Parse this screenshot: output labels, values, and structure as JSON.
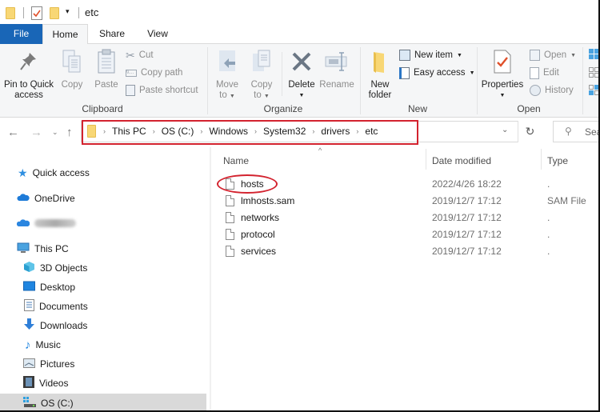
{
  "window": {
    "title": "etc"
  },
  "quick_access_toolbar": [
    "folder-icon",
    "properties-icon",
    "new-folder-icon",
    "customize-dropdown"
  ],
  "tabs": [
    {
      "label": "File",
      "active": false
    },
    {
      "label": "Home",
      "active": true
    },
    {
      "label": "Share",
      "active": false
    },
    {
      "label": "View",
      "active": false
    }
  ],
  "ribbon": {
    "clipboard": {
      "label": "Clipboard",
      "pin": "Pin to Quick access",
      "pin_line1": "Pin to Quick",
      "pin_line2": "access",
      "copy": "Copy",
      "paste": "Paste",
      "cut": "Cut",
      "copy_path": "Copy path",
      "paste_shortcut": "Paste shortcut"
    },
    "organize": {
      "label": "Organize",
      "move_to_1": "Move",
      "move_to_2": "to",
      "copy_to_1": "Copy",
      "copy_to_2": "to",
      "delete": "Delete",
      "rename": "Rename"
    },
    "new": {
      "label": "New",
      "new_folder_1": "New",
      "new_folder_2": "folder",
      "new_item": "New item",
      "easy_access": "Easy access"
    },
    "open": {
      "label": "Open",
      "properties": "Properties",
      "open": "Open",
      "edit": "Edit",
      "history": "History"
    }
  },
  "address_bar": {
    "breadcrumbs": [
      "This PC",
      "OS (C:)",
      "Windows",
      "System32",
      "drivers",
      "etc"
    ],
    "search_placeholder": "Sea",
    "highlight_color": "#d3232f"
  },
  "sidebar": {
    "items": [
      {
        "label": "Quick access",
        "icon": "star-icon"
      },
      {
        "label": "OneDrive",
        "icon": "cloud-icon"
      },
      {
        "label": "",
        "icon": "cloud-icon",
        "blurred": true
      },
      {
        "label": "This PC",
        "icon": "monitor-icon"
      },
      {
        "label": "3D Objects",
        "icon": "cube-icon"
      },
      {
        "label": "Desktop",
        "icon": "desktop-icon"
      },
      {
        "label": "Documents",
        "icon": "document-icon"
      },
      {
        "label": "Downloads",
        "icon": "download-icon"
      },
      {
        "label": "Music",
        "icon": "music-icon"
      },
      {
        "label": "Pictures",
        "icon": "picture-icon"
      },
      {
        "label": "Videos",
        "icon": "video-icon"
      },
      {
        "label": "OS (C:)",
        "icon": "drive-icon",
        "selected": true
      }
    ]
  },
  "file_list": {
    "columns": [
      "Name",
      "Date modified",
      "Type"
    ],
    "rows": [
      {
        "name": "hosts",
        "date": "2022/4/26 18:22",
        "type": ".",
        "highlighted": true
      },
      {
        "name": "lmhosts.sam",
        "date": "2019/12/7 17:12",
        "type": "SAM File"
      },
      {
        "name": "networks",
        "date": "2019/12/7 17:12",
        "type": "."
      },
      {
        "name": "protocol",
        "date": "2019/12/7 17:12",
        "type": "."
      },
      {
        "name": "services",
        "date": "2019/12/7 17:12",
        "type": "."
      }
    ]
  }
}
